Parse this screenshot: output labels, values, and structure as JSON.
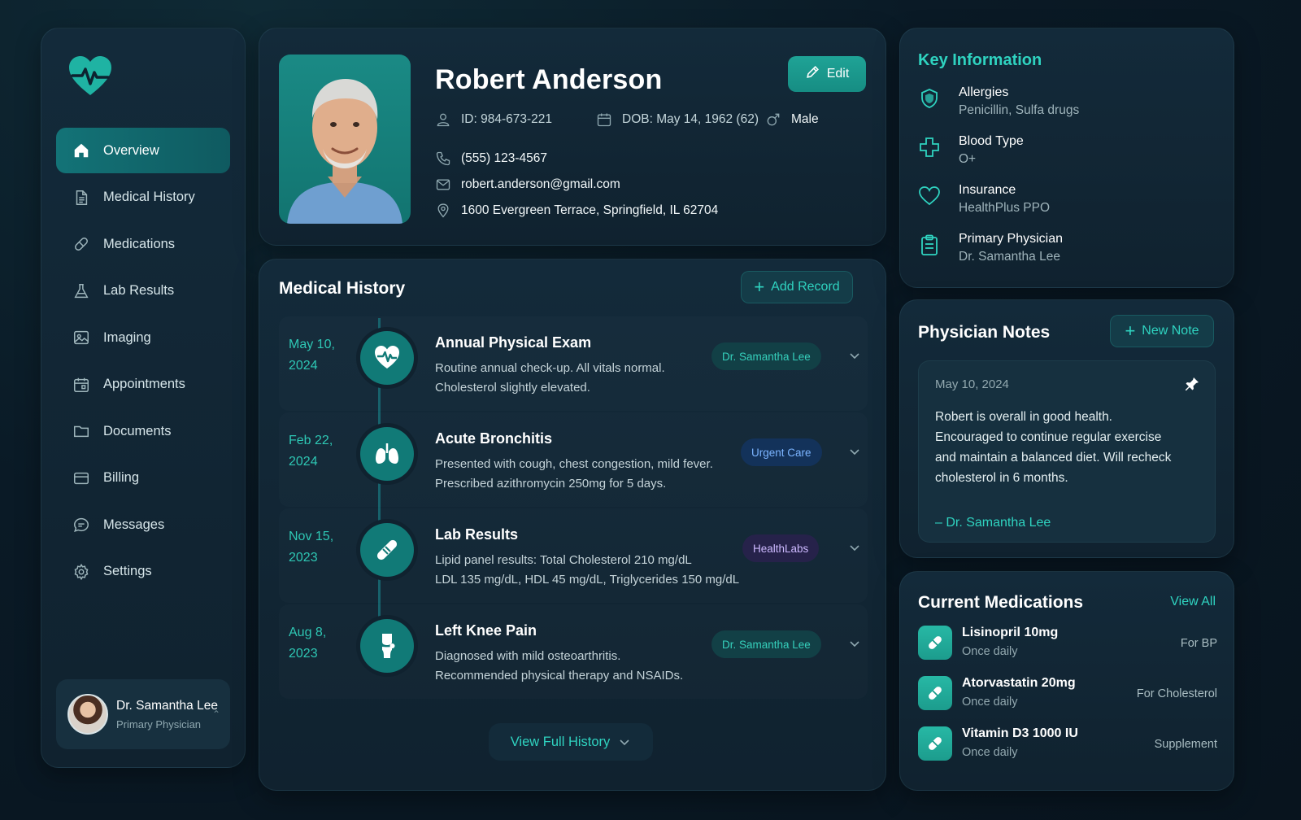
{
  "nav": {
    "items": [
      {
        "label": "Overview",
        "icon": "home-icon",
        "active": true
      },
      {
        "label": "Medical History",
        "icon": "document-icon"
      },
      {
        "label": "Medications",
        "icon": "pill-icon"
      },
      {
        "label": "Lab Results",
        "icon": "flask-icon"
      },
      {
        "label": "Imaging",
        "icon": "image-icon"
      },
      {
        "label": "Appointments",
        "icon": "calendar-icon"
      },
      {
        "label": "Documents",
        "icon": "folder-icon"
      },
      {
        "label": "Billing",
        "icon": "card-icon"
      },
      {
        "label": "Messages",
        "icon": "chat-icon"
      },
      {
        "label": "Settings",
        "icon": "gear-icon"
      }
    ],
    "user": {
      "name": "Dr. Samantha Lee",
      "role": "Primary Physician"
    }
  },
  "patient": {
    "name": "Robert Anderson",
    "edit_label": "Edit",
    "id": "ID: 984-673-221",
    "dob": "DOB: May 14, 1962 (62)",
    "sex": "Male",
    "phone": "(555) 123-4567",
    "email": "robert.anderson@gmail.com",
    "address": "1600 Evergreen Terrace, Springfield, IL 62704"
  },
  "history": {
    "title": "Medical History",
    "add_label": "Add Record",
    "view_full_label": "View Full History",
    "entries": [
      {
        "date": "May 10, 2024",
        "title": "Annual Physical Exam",
        "desc1": "Routine annual check-up. All vitals normal.",
        "desc2": "Cholesterol slightly elevated.",
        "tag": "Dr. Samantha Lee",
        "icon": "heartbeat-icon"
      },
      {
        "date": "Feb 22, 2024",
        "title": "Acute Bronchitis",
        "desc1": "Presented with cough, chest congestion, mild fever.",
        "desc2": "Prescribed azithromycin 250mg for 5 days.",
        "tag": "Urgent Care",
        "icon": "lungs-icon"
      },
      {
        "date": "Nov 15, 2023",
        "title": "Lab Results",
        "desc1": "Lipid panel results: Total Cholesterol 210 mg/dL",
        "desc2": "LDL 135 mg/dL, HDL 45 mg/dL, Triglycerides 150 mg/dL",
        "tag": "HealthLabs",
        "icon": "test-tube-icon"
      },
      {
        "date": "Aug 8, 2023",
        "title": "Left Knee Pain",
        "desc1": "Diagnosed with mild osteoarthritis.",
        "desc2": "Recommended physical therapy and NSAIDs.",
        "tag": "Dr. Samantha Lee",
        "icon": "knee-joint-icon"
      }
    ]
  },
  "key_info": {
    "title": "Key Information",
    "items": [
      {
        "label": "Allergies",
        "value": "Penicillin, Sulfa drugs",
        "icon": "shield-icon"
      },
      {
        "label": "Blood Type",
        "value": "O+",
        "icon": "medical-cross-icon"
      },
      {
        "label": "Insurance",
        "value": "HealthPlus PPO",
        "icon": "heart-icon"
      },
      {
        "label": "Primary Physician",
        "value": "Dr. Samantha Lee",
        "icon": "clipboard-icon"
      }
    ]
  },
  "notes": {
    "title": "Physician Notes",
    "new_label": "New Note",
    "date": "May 10, 2024",
    "text": "Robert is overall in good health. Encouraged to continue regular exercise and maintain a balanced diet. Will recheck cholesterol in 6 months.",
    "signature": "– Dr. Samantha Lee"
  },
  "medications": {
    "title": "Current Medications",
    "view_all_label": "View All",
    "items": [
      {
        "name": "Lisinopril 10mg",
        "freq": "Once daily",
        "tag": "For BP"
      },
      {
        "name": "Atorvastatin 20mg",
        "freq": "Once daily",
        "tag": "For Cholesterol"
      },
      {
        "name": "Vitamin D3 1000 IU",
        "freq": "Once daily",
        "tag": "Supplement"
      }
    ]
  },
  "colors": {
    "accent": "#2fd3c0",
    "active_nav": "#137377",
    "background": "#0a1a26",
    "panel": "#132a3a"
  }
}
